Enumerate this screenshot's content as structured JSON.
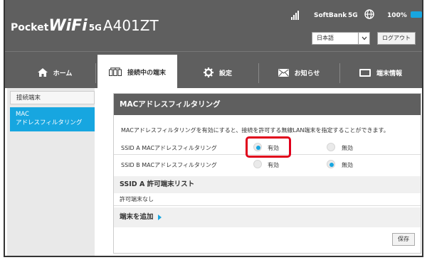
{
  "header": {
    "brand_pocket": "Pocket",
    "brand_wifi": "WiFi",
    "brand_5g": "5G",
    "brand_model": "A401ZT",
    "carrier": "SoftBank",
    "network": "5G",
    "battery": "100%",
    "language": "日本語",
    "logout_label": "ログアウト"
  },
  "nav": {
    "tabs": [
      {
        "label": "ホーム",
        "icon": "home-icon"
      },
      {
        "label": "接続中の端末",
        "icon": "devices-icon",
        "active": true
      },
      {
        "label": "設定",
        "icon": "gear-icon"
      },
      {
        "label": "お知らせ",
        "icon": "mail-icon"
      },
      {
        "label": "端末情報",
        "icon": "device-info-icon"
      }
    ]
  },
  "sidebar": {
    "items": [
      {
        "label": "接続端末"
      },
      {
        "label_line1": "MAC",
        "label_line2": "アドレスフィルタリング",
        "active": true
      }
    ]
  },
  "main": {
    "title": "MACアドレスフィルタリング",
    "description": "MACアドレスフィルタリングを有効にすると、接続を許可する無線LAN端末を指定することができます。",
    "rows": [
      {
        "label": "SSID A MACアドレスフィルタリング",
        "on_label": "有効",
        "off_label": "無効",
        "selected": "on"
      },
      {
        "label": "SSID B MACアドレスフィルタリング",
        "on_label": "有効",
        "off_label": "無効",
        "selected": "off"
      }
    ],
    "allowed_list_title": "SSID A 許可端末リスト",
    "allowed_none": "許可端末なし",
    "add_label": "端末を追加",
    "save_label": "保存"
  },
  "colors": {
    "accent": "#17a6e0",
    "header_bg": "#5f5f5f",
    "highlight": "#e0001b"
  }
}
